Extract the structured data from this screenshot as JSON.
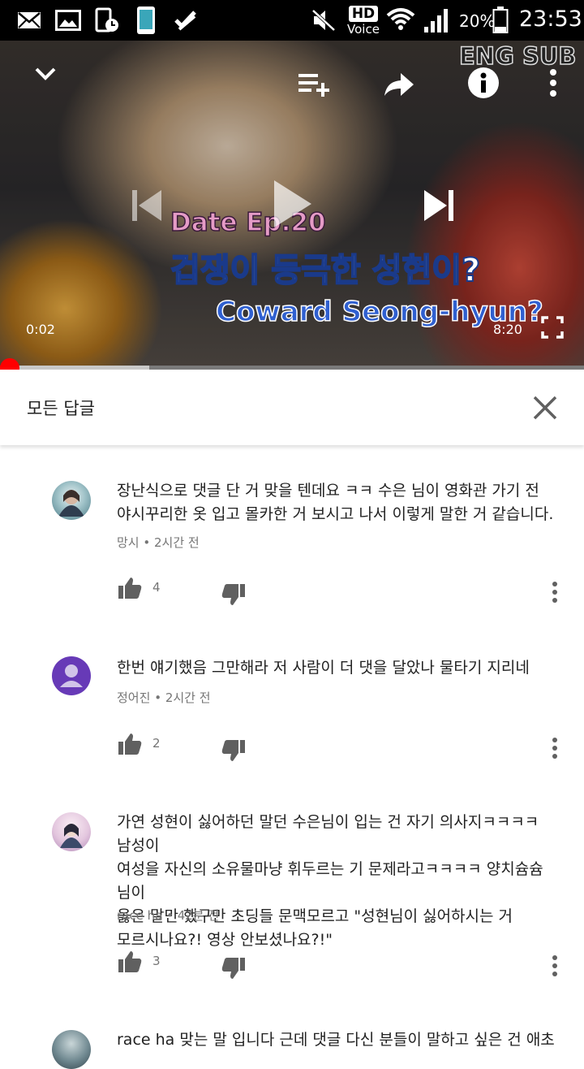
{
  "status_bar": {
    "battery": "20%",
    "time": "23:53",
    "hd_label": "HD",
    "voice_label": "Voice",
    "icons": [
      "email-icon",
      "gallery-icon",
      "phone-clock-icon",
      "phone-icon",
      "check-icon",
      "mute-icon",
      "wifi-icon",
      "signal-icon",
      "battery-icon"
    ]
  },
  "video": {
    "current_time": "0:02",
    "duration": "8:20",
    "progress_fraction": 0.004,
    "buffered_fraction": 0.255,
    "overlay": {
      "eng_sub": "ENG SUB",
      "episode": "Date Ep.20",
      "korean_title": "겁쟁이 등극한 성현이?",
      "english_title": "Coward Seong-hyun?"
    },
    "colors": {
      "progress": "#ff0000"
    }
  },
  "replies": {
    "title": "모든 답글",
    "comments": [
      {
        "text_line1": "장난식으로 댓글 단 거 맞을 텐데요 ㅋㅋ 수은 님이 영화관 가기 전",
        "text_line2": "야시꾸리한 옷 입고 몰카한 거 보시고 나서 이렇게 말한 거 같습니다.",
        "author": "망시",
        "time": "2시간 전",
        "likes": "4"
      },
      {
        "text_line1": "한번 얘기했음 그만해라 저 사람이 더 댓을 달았나 물타기 지리네",
        "author": "정어진",
        "time": "2시간 전",
        "likes": "2"
      },
      {
        "text_line1": "가연 성현이 싫어하던 말던 수은님이 입는 건 자기 의사지ㅋㅋㅋㅋ 남성이",
        "text_line2": "여성을 자신의 소유물마냥 휘두르는 기 문제라고ㅋㅋㅋㅋ 양치슘슘님이",
        "text_line3": "옳은 말만 했구만 초딩들 문맥모르고 \"성현님이 싫어하시는 거",
        "text_line4": "모르시나요?! 영상 안보셨나요?!\"",
        "author": "race ha",
        "time": "42분 전",
        "likes": "3"
      },
      {
        "text_line1": "race ha 맞는 말 입니다 근데 댓글 다신 분들이 말하고 싶은 건 애초에"
      }
    ]
  }
}
